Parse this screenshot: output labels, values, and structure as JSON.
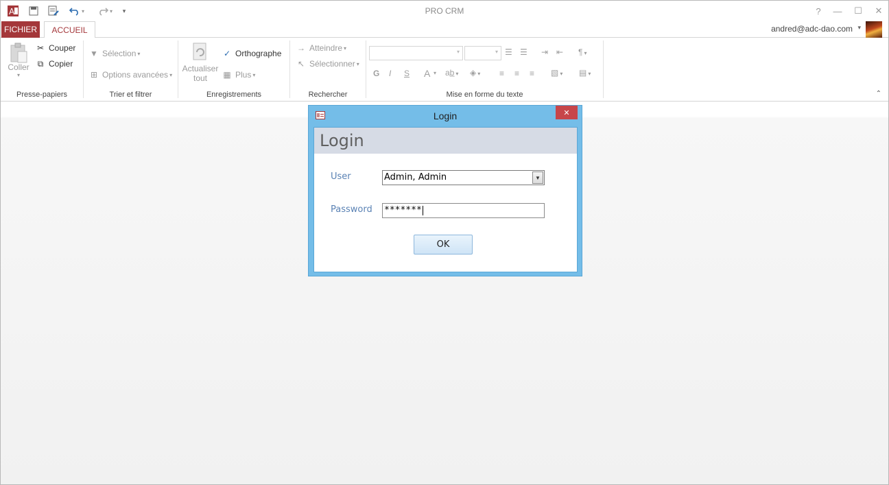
{
  "window": {
    "title": "PRO CRM",
    "controls": {
      "help": "?",
      "minimize": "—",
      "maximize": "☐",
      "close": "✕"
    }
  },
  "qat": {
    "app_icon": "access-icon",
    "items": [
      "save-icon",
      "form-icon",
      "undo-icon",
      "redo-icon",
      "customize-icon"
    ]
  },
  "tabs": {
    "file": "FICHIER",
    "home": "ACCUEIL"
  },
  "account": {
    "email": "andred@adc-dao.com"
  },
  "ribbon": {
    "clipboard": {
      "label": "Presse-papiers",
      "paste": "Coller",
      "cut": "Couper",
      "copy": "Copier"
    },
    "sort": {
      "label": "Trier et filtrer",
      "selection": "Sélection",
      "advanced": "Options avancées"
    },
    "records": {
      "label": "Enregistrements",
      "refresh_line1": "Actualiser",
      "refresh_line2": "tout",
      "spelling": "Orthographe",
      "more": "Plus"
    },
    "find": {
      "label": "Rechercher",
      "goto": "Atteindre",
      "select": "Sélectionner"
    },
    "text": {
      "label": "Mise en forme du texte",
      "bold": "G",
      "italic": "I",
      "underline": "S",
      "font_color": "A"
    }
  },
  "dialog": {
    "title": "Login",
    "close": "✕",
    "header": "Login",
    "user_label": "User",
    "user_value": "Admin, Admin",
    "password_label": "Password",
    "password_value": "*******",
    "ok": "OK"
  },
  "colors": {
    "accent": "#a4373a",
    "dialog_frame": "#74bde8",
    "label_blue": "#5a82b4"
  }
}
